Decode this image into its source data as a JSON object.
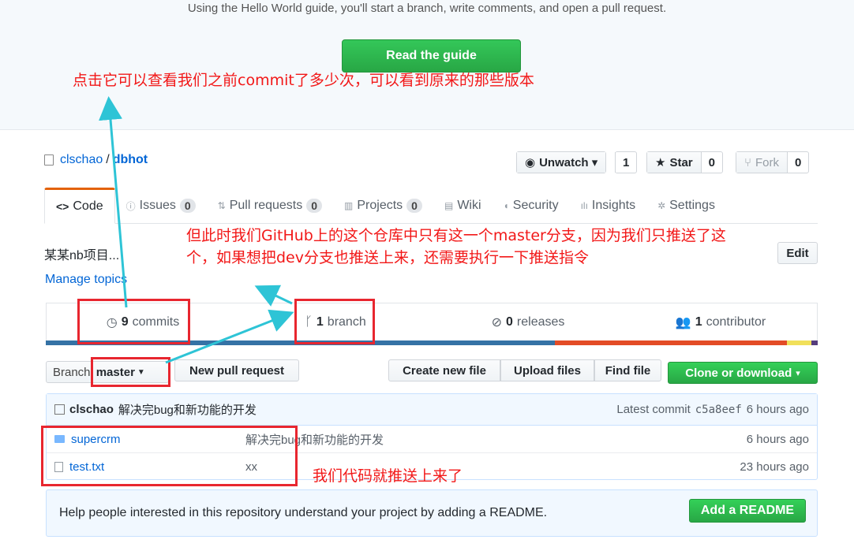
{
  "hero": {
    "text": "Using the Hello World guide, you'll start a branch, write comments, and open a pull request.",
    "button": "Read the guide"
  },
  "annotations": {
    "commits_note": "点击它可以查看我们之前commit了多少次，可以看到原来的那些版本",
    "branch_note_line1": "但此时我们GitHub上的这个仓库中只有这一个master分支，因为我们只推送了这",
    "branch_note_line2": "个，如果想把dev分支也推送上来，还需要执行一下推送指令",
    "files_note": "我们代码就推送上来了"
  },
  "repo": {
    "owner": "clschao",
    "separator": "/",
    "name": "dbhot"
  },
  "social": {
    "watch_label": "Unwatch ▾",
    "watch_count": "1",
    "star_label": "Star",
    "star_count": "0",
    "fork_label": "Fork",
    "fork_count": "0"
  },
  "tabs": [
    {
      "label": "Code",
      "icon": "<>"
    },
    {
      "label": "Issues",
      "count": "0",
      "icon": "issue-icon"
    },
    {
      "label": "Pull requests",
      "count": "0",
      "icon": "pr-icon"
    },
    {
      "label": "Projects",
      "count": "0",
      "icon": "project-icon"
    },
    {
      "label": "Wiki",
      "icon": "wiki-icon"
    },
    {
      "label": "Security",
      "icon": "shield-icon"
    },
    {
      "label": "Insights",
      "icon": "graph-icon"
    },
    {
      "label": "Settings",
      "icon": "gear-icon"
    }
  ],
  "description": "某某nb项目...",
  "edit_label": "Edit",
  "topics_link": "Manage topics",
  "summary": {
    "commits_num": "9",
    "commits_label": "commits",
    "branch_num": "1",
    "branch_label": "branch",
    "releases_num": "0",
    "releases_label": "releases",
    "contributors_num": "1",
    "contributors_label": "contributor"
  },
  "language_colors": [
    "#3572A5",
    "#e34c26",
    "#f1e05a",
    "#563d7c"
  ],
  "toolbar": {
    "branch_prefix": "Branch:",
    "branch_value": "master",
    "new_pr": "New pull request",
    "create_file": "Create new file",
    "upload": "Upload files",
    "find": "Find file",
    "clone": "Clone or download"
  },
  "latest_commit": {
    "author": "clschao",
    "message": "解决完bug和新功能的开发",
    "prefix": "Latest commit",
    "sha": "c5a8eef",
    "age": "6 hours ago"
  },
  "files": [
    {
      "name": "supercrm",
      "type": "folder",
      "message": "解决完bug和新功能的开发",
      "age": "6 hours ago"
    },
    {
      "name": "test.txt",
      "type": "file",
      "message": "xx",
      "age": "23 hours ago"
    }
  ],
  "readme": {
    "text": "Help people interested in this repository understand your project by adding a README.",
    "button": "Add a README"
  }
}
